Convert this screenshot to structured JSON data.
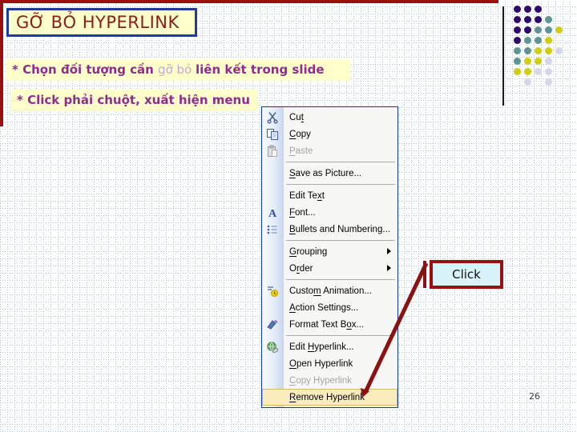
{
  "colors": {
    "accent-red": "#9B0F0F",
    "title-red": "#8E1A1A",
    "cream": "#FFFFCC",
    "purple-text": "#8E2D8E",
    "muted-link": "#C5A8CD",
    "menu-border": "#0B35A8",
    "menu-bg": "#F7F7F5",
    "highlight-bg": "#FBECBE",
    "highlight-border": "#D9B964",
    "callout-fill": "#D8F3F9",
    "grid-line": "#A9BCCB",
    "disabled-text": "#A5A5A5"
  },
  "decor": {
    "dot_palette": {
      "P": "#2E0A6E",
      "T": "#5E9494",
      "Y": "#CFCF10",
      "L": "#D6D6EA"
    },
    "dot_grid": [
      "PPP..",
      "PPPT.",
      "PPTTY",
      "PTTY.",
      "TTYYL",
      "TYYL.",
      "YYLL.",
      ".L.L."
    ]
  },
  "slide": {
    "title": "GỠ BỎ HYPERLINK",
    "bullet1": {
      "pre": "* Chọn đối tượng cần ",
      "link": "gỡ bỏ ",
      "post": "liên kết trong slide"
    },
    "bullet2": "* Click phải chuột, xuất hiện menu",
    "callout_label": "Click",
    "page_number": "26"
  },
  "context_menu": {
    "items": [
      {
        "label": "Cut",
        "accel_index": 2,
        "icon": "scissors-icon",
        "state": "normal",
        "submenu": false,
        "separator_after": false
      },
      {
        "label": "Copy",
        "accel_index": 0,
        "icon": "copy-icon",
        "state": "normal",
        "submenu": false,
        "separator_after": false
      },
      {
        "label": "Paste",
        "accel_index": 0,
        "icon": "paste-icon",
        "state": "disabled",
        "submenu": false,
        "separator_after": true
      },
      {
        "label": "Save as Picture...",
        "accel_index": 0,
        "icon": null,
        "state": "normal",
        "submenu": false,
        "separator_after": true
      },
      {
        "label": "Edit Text",
        "accel_index": 7,
        "icon": null,
        "state": "normal",
        "submenu": false,
        "separator_after": false
      },
      {
        "label": "Font...",
        "accel_index": 0,
        "icon": "font-icon",
        "state": "normal",
        "submenu": false,
        "separator_after": false
      },
      {
        "label": "Bullets and Numbering...",
        "accel_index": 0,
        "icon": "bullets-icon",
        "state": "normal",
        "submenu": false,
        "separator_after": true
      },
      {
        "label": "Grouping",
        "accel_index": 0,
        "icon": null,
        "state": "normal",
        "submenu": true,
        "separator_after": false
      },
      {
        "label": "Order",
        "accel_index": 1,
        "icon": null,
        "state": "normal",
        "submenu": true,
        "separator_after": true
      },
      {
        "label": "Custom Animation...",
        "accel_index": 5,
        "icon": "custom-animation-icon",
        "state": "normal",
        "submenu": false,
        "separator_after": false
      },
      {
        "label": "Action Settings...",
        "accel_index": 0,
        "icon": null,
        "state": "normal",
        "submenu": false,
        "separator_after": false
      },
      {
        "label": "Format Text Box...",
        "accel_index": 13,
        "icon": "format-icon",
        "state": "normal",
        "submenu": false,
        "separator_after": true
      },
      {
        "label": "Edit Hyperlink...",
        "accel_index": 5,
        "icon": "hyperlink-icon",
        "state": "normal",
        "submenu": false,
        "separator_after": false
      },
      {
        "label": "Open Hyperlink",
        "accel_index": 0,
        "icon": null,
        "state": "normal",
        "submenu": false,
        "separator_after": false
      },
      {
        "label": "Copy Hyperlink",
        "accel_index": 0,
        "icon": null,
        "state": "disabled",
        "submenu": false,
        "separator_after": false
      },
      {
        "label": "Remove Hyperlink",
        "accel_index": 0,
        "icon": null,
        "state": "highlighted",
        "submenu": false,
        "separator_after": false
      }
    ]
  }
}
